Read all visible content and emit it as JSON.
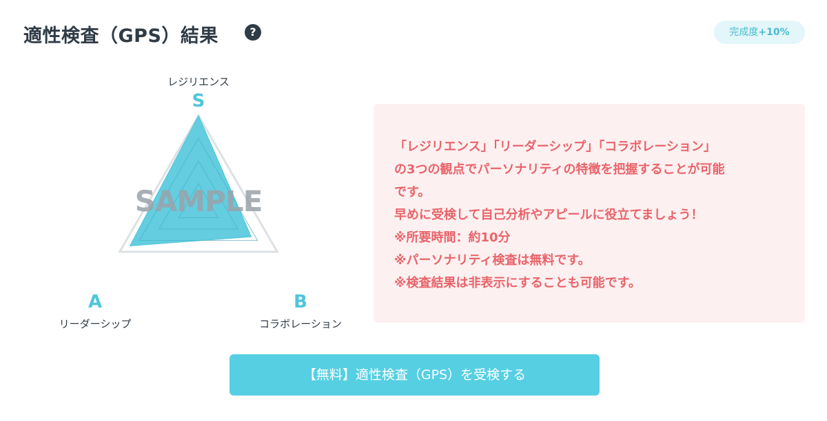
{
  "header": {
    "title": "適性検査（GPS）結果",
    "help_icon": "question-circle-icon",
    "badge_label": "完成度",
    "badge_value": "+10%"
  },
  "chart_data": {
    "type": "radar",
    "axes": [
      {
        "name": "レジリエンス",
        "grade": "S"
      },
      {
        "name": "コラボレーション",
        "grade": "B"
      },
      {
        "name": "リーダーシップ",
        "grade": "A"
      }
    ],
    "grade_scale": [
      "S",
      "A",
      "B",
      "C",
      "D"
    ],
    "values": [
      1.0,
      0.67,
      0.87
    ],
    "watermark": "SAMPLE",
    "colors": {
      "fill": "#4fc6dc",
      "grid": "#d9dde0",
      "grade_text": "#4fc6dc"
    }
  },
  "info": {
    "lines": [
      "「レジリエンス」「リーダーシップ」「コラボレーション」",
      "の3つの観点でパーソナリティの特徴を把握することが可能",
      "です。",
      "早めに受検して自己分析やアピールに役立てましょう！",
      "※所要時間：約10分",
      "※パーソナリティ検査は無料です。",
      "※検査結果は非表示にすることも可能です。"
    ],
    "text_color": "#e8646a",
    "background": "#fdf0f0"
  },
  "cta": {
    "label": "【無料】適性検査（GPS）を受検する",
    "background": "#56cfe3"
  }
}
